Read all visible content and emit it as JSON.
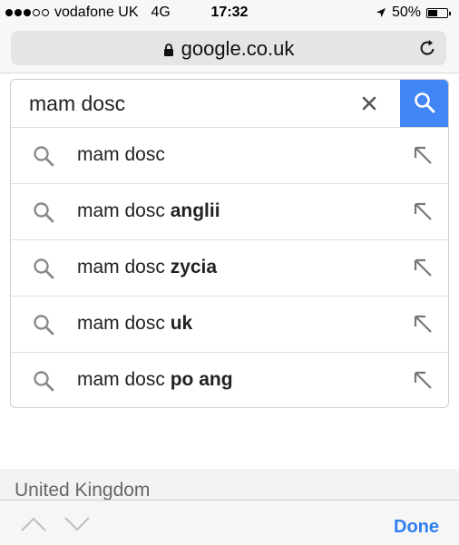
{
  "status_bar": {
    "signal_dots_full": 3,
    "signal_dots_empty": 2,
    "carrier": "vodafone UK",
    "network": "4G",
    "time": "17:32",
    "battery_percent_text": "50%",
    "battery_level": 0.5,
    "location_icon": "location-arrow-icon"
  },
  "url_bar": {
    "url": "google.co.uk",
    "lock_icon": "lock-icon",
    "reload_icon": "reload-icon"
  },
  "search": {
    "query": "mam dosc",
    "clear_icon": "close-icon",
    "button_icon": "search-icon",
    "button_color": "#4285f4"
  },
  "suggestions": [
    {
      "prefix": "mam dosc",
      "bold": ""
    },
    {
      "prefix": "mam dosc",
      "bold": "anglii"
    },
    {
      "prefix": "mam dosc",
      "bold": "zycia"
    },
    {
      "prefix": "mam dosc",
      "bold": "uk"
    },
    {
      "prefix": "mam dosc",
      "bold": "po ang"
    }
  ],
  "footer": {
    "region": "United Kingdom"
  },
  "keyboard_toolbar": {
    "done_label": "Done",
    "done_color": "#2e7ef0"
  }
}
